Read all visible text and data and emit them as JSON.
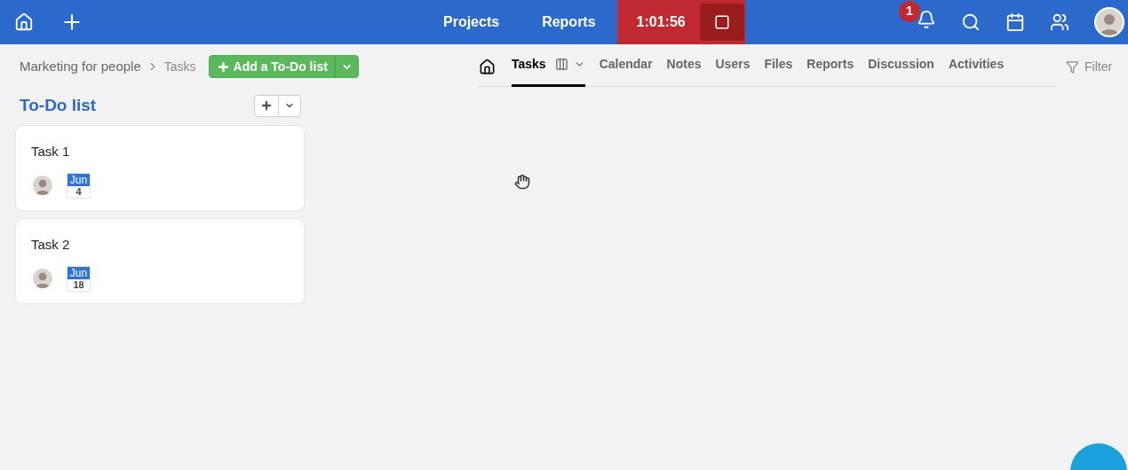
{
  "topbar": {
    "nav": [
      "Projects",
      "Reports"
    ],
    "timer": "1:01:56",
    "notification_count": "1"
  },
  "breadcrumb": {
    "project": "Marketing for people",
    "page": "Tasks"
  },
  "add_button": "Add a To-Do list",
  "list": {
    "title": "To-Do list",
    "tasks": [
      {
        "title": "Task 1",
        "month": "Jun",
        "day": "4"
      },
      {
        "title": "Task 2",
        "month": "Jun",
        "day": "18"
      }
    ]
  },
  "tabs": [
    {
      "label": "Tasks",
      "selected": true
    },
    {
      "label": "Calendar",
      "selected": false
    },
    {
      "label": "Notes",
      "selected": false
    },
    {
      "label": "Users",
      "selected": false
    },
    {
      "label": "Files",
      "selected": false
    },
    {
      "label": "Reports",
      "selected": false
    },
    {
      "label": "Discussion",
      "selected": false
    },
    {
      "label": "Activities",
      "selected": false
    }
  ],
  "filter": "Filter"
}
